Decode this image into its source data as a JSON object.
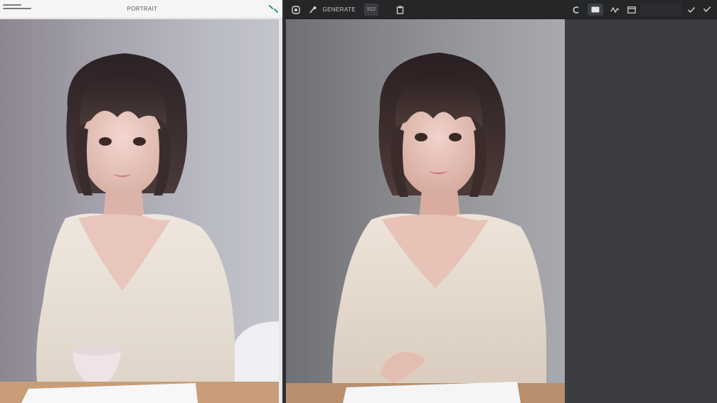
{
  "left_window": {
    "title": "PORTRAIT"
  },
  "right_window": {
    "toolbar": {
      "items": [
        {
          "name": "app-logo-icon",
          "label": ""
        },
        {
          "name": "brush-icon",
          "label": ""
        },
        {
          "name": "model-selector",
          "label": "GENERATE"
        },
        {
          "name": "size-chip",
          "label": "512"
        },
        {
          "name": "paste-icon",
          "label": ""
        },
        {
          "name": "undo-icon",
          "label": ""
        },
        {
          "name": "frame-icon",
          "label": ""
        },
        {
          "name": "wave-icon",
          "label": ""
        },
        {
          "name": "image-icon",
          "label": ""
        },
        {
          "name": "check-icon",
          "label": ""
        },
        {
          "name": "expand-icon",
          "label": ""
        }
      ]
    }
  },
  "colors": {
    "left_bg": "#f3f3f3",
    "dark_toolbar": "#242628",
    "dark_panel": "#3b3d40",
    "accent_green": "#1fa37a"
  }
}
